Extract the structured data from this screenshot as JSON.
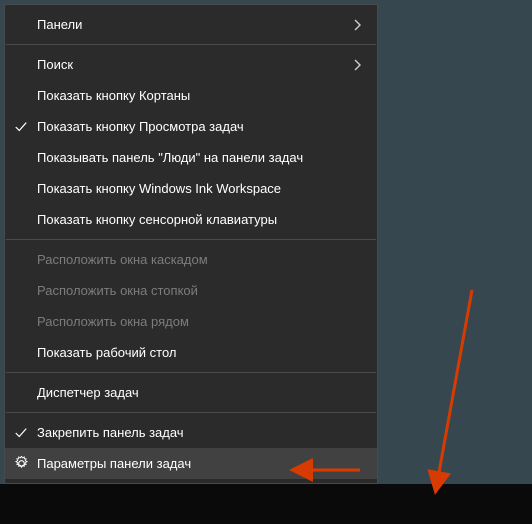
{
  "menu": {
    "items": [
      {
        "label": "Панели",
        "submenu": true
      },
      {
        "sep": true
      },
      {
        "label": "Поиск",
        "submenu": true
      },
      {
        "label": "Показать кнопку Кортаны"
      },
      {
        "label": "Показать кнопку Просмотра задач",
        "checked": true
      },
      {
        "label": "Показывать панель \"Люди\" на панели задач"
      },
      {
        "label": "Показать кнопку Windows Ink Workspace"
      },
      {
        "label": "Показать кнопку сенсорной клавиатуры"
      },
      {
        "sep": true
      },
      {
        "label": "Расположить окна каскадом",
        "disabled": true
      },
      {
        "label": "Расположить окна стопкой",
        "disabled": true
      },
      {
        "label": "Расположить окна рядом",
        "disabled": true
      },
      {
        "label": "Показать рабочий стол"
      },
      {
        "sep": true
      },
      {
        "label": "Диспетчер задач"
      },
      {
        "sep": true
      },
      {
        "label": "Закрепить панель задач",
        "checked": true
      },
      {
        "label": "Параметры панели задач",
        "highlighted": true,
        "icon": "gear"
      }
    ]
  }
}
